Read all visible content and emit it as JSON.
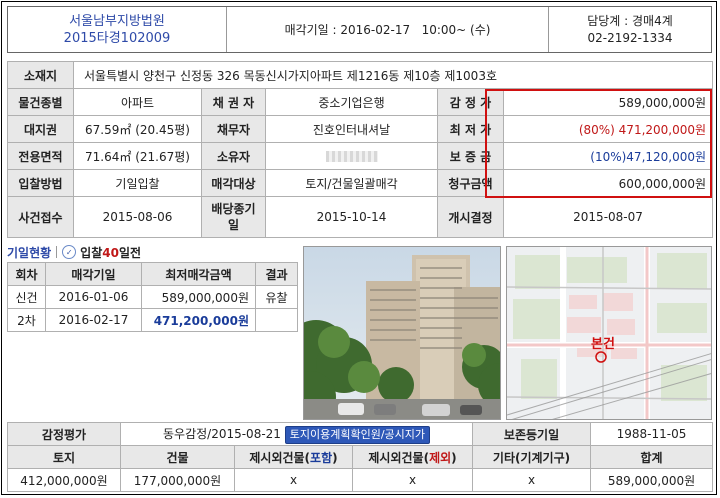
{
  "header": {
    "court": "서울남부지방법원",
    "case_no": "2015타경102009",
    "auction_date": "매각기일 : 2016-02-17   10:00~ (수)",
    "manager": "담당계 : 경매4계",
    "phone": "02-2192-1334"
  },
  "address": {
    "label": "소재지",
    "value": "서울특별시 양천구 신정동 326 목동신시가지아파트 제1216동 제10층 제1003호"
  },
  "rows": {
    "r1": {
      "l1": "물건종별",
      "v1": "아파트",
      "l2": "채 권 자",
      "v2": "중소기업은행",
      "l3": "감 정 가",
      "v3": "589,000,000원"
    },
    "r2": {
      "l1": "대지권",
      "v1": "67.59㎡ (20.45평)",
      "l2": "채무자",
      "v2": "진호인터내셔날",
      "l3": "최 저 가",
      "v3a": "(80%) ",
      "v3b": "471,200,000원"
    },
    "r3": {
      "l1": "전용면적",
      "v1": "71.64㎡ (21.67평)",
      "l2": "소유자",
      "l3": "보 증 금",
      "v3": "(10%)47,120,000원"
    },
    "r4": {
      "l1": "입찰방법",
      "v1": "기일입찰",
      "l2": "매각대상",
      "v2": "토지/건물일괄매각",
      "l3": "청구금액",
      "v3": "600,000,000원"
    },
    "r5": {
      "l1": "사건접수",
      "v1": "2015-08-06",
      "l2a": "배당종기",
      "l2b": "일",
      "v2": "2015-10-14",
      "l3": "개시결정",
      "v3": "2015-08-07"
    }
  },
  "status": {
    "tab": "기일현황",
    "label_a": "입찰",
    "count": "40",
    "label_b": "일전"
  },
  "history": {
    "headers": [
      "회차",
      "매각기일",
      "최저매각금액",
      "결과"
    ],
    "rows": [
      {
        "round": "신건",
        "date": "2016-01-06",
        "amount": "589,000,000원",
        "result": "유찰"
      },
      {
        "round": "2차",
        "date": "2016-02-17",
        "amount": "471,200,000원",
        "result": ""
      }
    ]
  },
  "map": {
    "marker": "본건"
  },
  "appraisal": {
    "label": "감정평가",
    "value": "동우감정/2015-08-21",
    "button": "토지이용계획확인원/공시지가",
    "reg_label": "보존등기일",
    "reg_value": "1988-11-05",
    "cols": {
      "land": "토지",
      "building": "건물",
      "extra_a": "제시외건물(",
      "incl": "포함",
      "extra_b": "제시외건물(",
      "excl": "제외",
      "close": ")",
      "other": "기타(기계기구)",
      "total": "합계"
    },
    "vals": {
      "land": "412,000,000원",
      "building": "177,000,000원",
      "incl": "x",
      "excl": "x",
      "other": "x",
      "total": "589,000,000원"
    }
  },
  "colors": {
    "accent_blue": "#2e4aa8",
    "accent_red": "#c01818",
    "label_bg": "#e8e8e8"
  }
}
